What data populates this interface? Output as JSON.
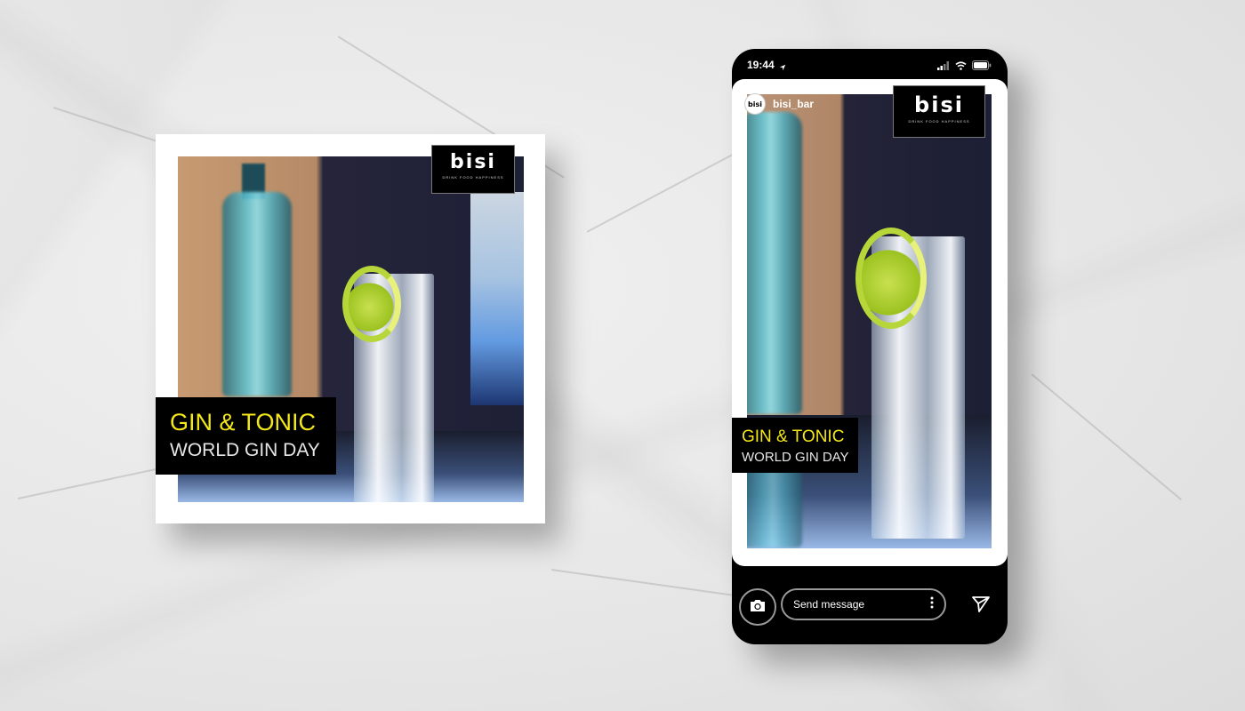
{
  "brand": {
    "logo_text": "bisi",
    "tagline": "DRINK FOOD HAPPINESS"
  },
  "post": {
    "title_line1": "GIN & TONIC",
    "title_line2": "WORLD GIN DAY"
  },
  "story": {
    "status_time": "19:44",
    "username": "bisi_bar",
    "avatar_text": "bisi",
    "title_line1": "GIN & TONIC",
    "title_line2": "WORLD GIN DAY",
    "message_placeholder": "Send message"
  },
  "icons": {
    "location": "location-arrow-icon",
    "signal": "signal-icon",
    "wifi": "wifi-icon",
    "battery": "battery-icon",
    "camera": "camera-icon",
    "more": "more-vertical-icon",
    "send": "send-icon"
  },
  "colors": {
    "title_yellow": "#f4e71a",
    "title_white": "#e6e6e6",
    "lime": "#b7d63a",
    "phone_black": "#000000"
  }
}
